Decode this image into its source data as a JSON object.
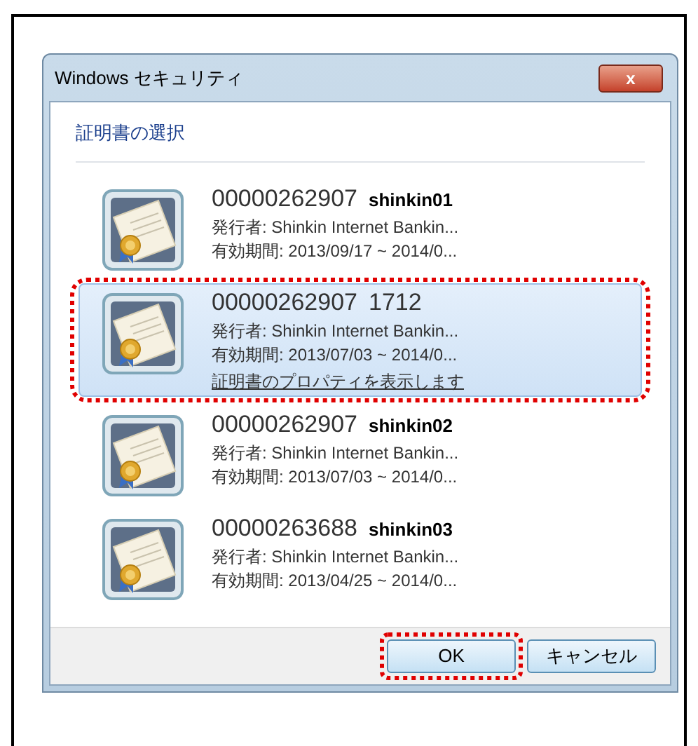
{
  "window": {
    "title": "Windows セキュリティ",
    "close": "x"
  },
  "heading": "証明書の選択",
  "certificates": [
    {
      "number": "00000262907",
      "name": "shinkin01",
      "name_bold": true,
      "issuer": "発行者: Shinkin Internet Bankin...",
      "validity": "有効期間: 2013/09/17 ~ 2014/0...",
      "selected": false,
      "highlighted": false
    },
    {
      "number": "00000262907",
      "name": "1712",
      "name_bold": false,
      "issuer": "発行者: Shinkin Internet Bankin...",
      "validity": "有効期間: 2013/07/03 ~ 2014/0...",
      "properties_link": "証明書のプロパティを表示します",
      "selected": true,
      "highlighted": true
    },
    {
      "number": "00000262907",
      "name": "shinkin02",
      "name_bold": true,
      "issuer": "発行者: Shinkin Internet Bankin...",
      "validity": "有効期間: 2013/07/03 ~ 2014/0...",
      "selected": false,
      "highlighted": false
    },
    {
      "number": "00000263688",
      "name": "shinkin03",
      "name_bold": true,
      "issuer": "発行者: Shinkin Internet Bankin...",
      "validity": "有効期間: 2013/04/25 ~ 2014/0...",
      "selected": false,
      "highlighted": false
    }
  ],
  "buttons": [
    {
      "label": "OK",
      "highlighted": true
    },
    {
      "label": "キャンセル",
      "highlighted": false
    }
  ]
}
